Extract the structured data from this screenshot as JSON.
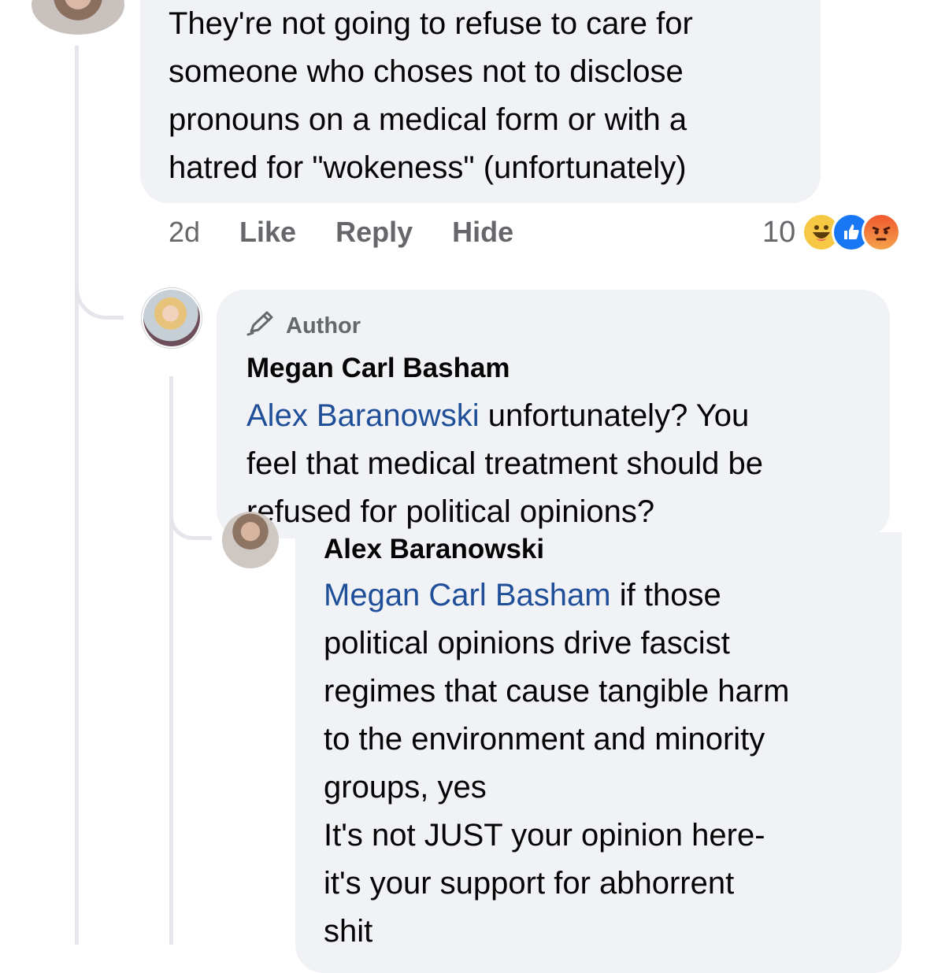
{
  "comments": [
    {
      "text_lines": [
        "They're not going to refuse to care for",
        "someone who choses not to disclose",
        "pronouns on a medical form or with a",
        "hatred for \"wokeness\" (unfortunately)"
      ],
      "actions": {
        "time": "2d",
        "like": "Like",
        "reply": "Reply",
        "hide": "Hide"
      },
      "reaction_count": "10",
      "reactions": [
        "haha-icon",
        "like-icon",
        "angry-icon"
      ]
    },
    {
      "badge": "Author",
      "author": "Megan Carl Basham",
      "mention": "Alex Baranowski",
      "text_first": " unfortunately? You",
      "text_lines": [
        "feel that medical treatment should be",
        "refused for political opinions?"
      ]
    },
    {
      "author": "Alex Baranowski",
      "mention": "Megan Carl Basham",
      "text_first": " if those",
      "text_lines": [
        "political opinions drive fascist",
        "regimes that cause tangible harm",
        "to the environment and minority",
        "groups, yes",
        "It's not JUST your opinion here-",
        "it's your support for abhorrent",
        "shit"
      ]
    }
  ],
  "colors": {
    "bubble": "#f0f2f5",
    "mention": "#1f4f99",
    "muted": "#65676b",
    "like": "#1877f2"
  }
}
